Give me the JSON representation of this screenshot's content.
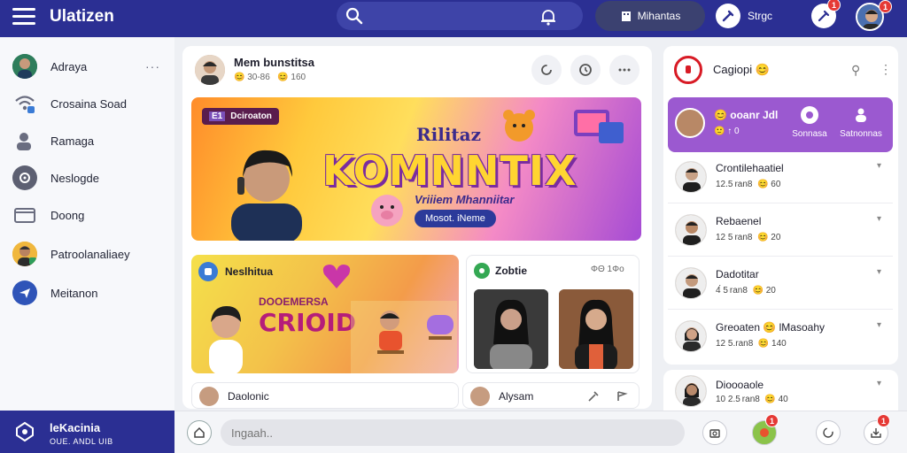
{
  "app": {
    "title": "Ulatizen"
  },
  "topbar": {
    "button1_label": "Mihantas",
    "button2_label": "Strgc",
    "notif_count": "1",
    "avatar_count": "1"
  },
  "sidebar": {
    "items": [
      {
        "label": "Adraya",
        "icon": "avatar-icon"
      },
      {
        "label": "Crosaina Soad",
        "icon": "wifi-icon"
      },
      {
        "label": "Ramaga",
        "icon": "user-icon"
      },
      {
        "label": "Neslogde",
        "icon": "settings-icon"
      },
      {
        "label": "Doong",
        "icon": "folder-icon"
      },
      {
        "label": "Patroolanaliaey",
        "icon": "avatar-icon"
      },
      {
        "label": "Meitanon",
        "icon": "send-icon"
      }
    ],
    "more_label": "···",
    "footer": {
      "title": "leKacinia",
      "subtitle": "OUE. ANDL UIB"
    }
  },
  "post": {
    "author": "Mem bunstitsa",
    "meta_time": "😊 30-86",
    "meta_reacts": "😊 160",
    "banner": {
      "tag": "Dciroaton",
      "tag_number": "E1",
      "small_title": "Rilitaz",
      "title": "KOMNNTIX",
      "subtitle": "Vriiiem Mhanniitar",
      "pill": "Mosot. iNeme"
    },
    "card1": {
      "header": "Neslhitua",
      "title_small": "DOOEMERSA",
      "title_big": "CRIOID"
    },
    "card2": {
      "header": "Zobtie",
      "meta": "ΦΘ  1Φο"
    },
    "row1": "Daolonic",
    "row2": "Alysam"
  },
  "right": {
    "header_title": "Cagiopi 😊",
    "highlight": {
      "name": "😊 ooanr Jdl",
      "meta": "🙂 ↑ 0",
      "btn1": "Sonnasa",
      "btn2": "Satnonnas"
    },
    "items": [
      {
        "name": "Crontilehaatiel",
        "date": "12.5 ran8",
        "count": "😊 60"
      },
      {
        "name": "Rebaenel",
        "date": "12 5 ran8",
        "count": "😊 20"
      },
      {
        "name": "Dadotitar",
        "date": "4́ 5 ran8",
        "count": "😊 20"
      },
      {
        "name": "Greoaten 😊 lMasoahy",
        "date": "12 5.ran8",
        "count": "😊 140"
      },
      {
        "name": "Dioooaole",
        "date": "10 2.5 ran8",
        "count": "😊 40"
      }
    ]
  },
  "bottom": {
    "input_placeholder": "Ingaah..",
    "badge1": "1",
    "badge2": "1"
  },
  "colors": {
    "primary": "#2b2f93",
    "accent": "#9b59d0",
    "badge": "#e53935"
  }
}
